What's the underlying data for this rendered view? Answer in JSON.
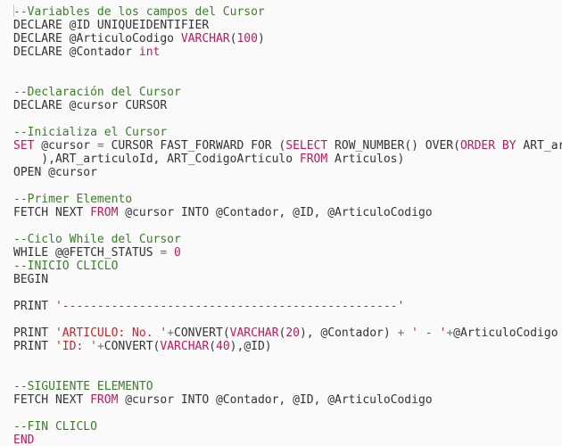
{
  "editor": {
    "language": "T-SQL",
    "colors": {
      "background": "#fafafa",
      "text": "#333333",
      "comment": "#3c7d2b",
      "keyword": "#c2185b",
      "number": "#c2185b",
      "string": "#d0202a",
      "operator": "#6b7280"
    },
    "lines": [
      [
        {
          "t": "cm",
          "v": "--Variables de los campos del Cursor"
        }
      ],
      [
        {
          "t": "tx",
          "v": "DECLARE @ID UNIQUEIDENTIFIER"
        }
      ],
      [
        {
          "t": "tx",
          "v": "DECLARE @ArticuloCodigo "
        },
        {
          "t": "kw",
          "v": "VARCHAR"
        },
        {
          "t": "tx",
          "v": "("
        },
        {
          "t": "num",
          "v": "100"
        },
        {
          "t": "tx",
          "v": ")"
        }
      ],
      [
        {
          "t": "tx",
          "v": "DECLARE @Contador "
        },
        {
          "t": "kw",
          "v": "int"
        }
      ],
      [],
      [],
      [
        {
          "t": "cm",
          "v": "--Declaración del Cursor"
        }
      ],
      [
        {
          "t": "tx",
          "v": "DECLARE @cursor CURSOR"
        }
      ],
      [],
      [
        {
          "t": "cm",
          "v": "--Inicializa el Cursor"
        }
      ],
      [
        {
          "t": "kw",
          "v": "SET"
        },
        {
          "t": "tx",
          "v": " @cursor "
        },
        {
          "t": "op",
          "v": "="
        },
        {
          "t": "tx",
          "v": " CURSOR FAST_FORWARD FOR ("
        },
        {
          "t": "kw",
          "v": "SELECT"
        },
        {
          "t": "tx",
          "v": " ROW_NUMBER() OVER("
        },
        {
          "t": "kw",
          "v": "ORDER BY"
        },
        {
          "t": "tx",
          "v": " ART_articuloId"
        }
      ],
      [
        {
          "t": "tx",
          "v": "    ),ART_articuloId, ART_CodigoArticulo "
        },
        {
          "t": "kw",
          "v": "FROM"
        },
        {
          "t": "tx",
          "v": " Articulos)"
        }
      ],
      [
        {
          "t": "tx",
          "v": "OPEN @cursor"
        }
      ],
      [],
      [
        {
          "t": "cm",
          "v": "--Primer Elemento"
        }
      ],
      [
        {
          "t": "tx",
          "v": "FETCH NEXT "
        },
        {
          "t": "kw",
          "v": "FROM"
        },
        {
          "t": "tx",
          "v": " @cursor INTO @Contador, @ID, @ArticuloCodigo"
        }
      ],
      [],
      [
        {
          "t": "cm",
          "v": "--Ciclo While del Cursor"
        }
      ],
      [
        {
          "t": "tx",
          "v": "WHILE @@FETCH_STATUS "
        },
        {
          "t": "op",
          "v": "="
        },
        {
          "t": "tx",
          "v": " "
        },
        {
          "t": "num",
          "v": "0"
        }
      ],
      [
        {
          "t": "cm",
          "v": "--INICIO CLICLO"
        }
      ],
      [
        {
          "t": "tx",
          "v": "BEGIN"
        }
      ],
      [],
      [
        {
          "t": "tx",
          "v": "PRINT "
        },
        {
          "t": "str",
          "v": "'------------------------------------------------'"
        }
      ],
      [],
      [
        {
          "t": "tx",
          "v": "PRINT "
        },
        {
          "t": "str",
          "v": "'ARTICULO: No. '"
        },
        {
          "t": "op",
          "v": "+"
        },
        {
          "t": "tx",
          "v": "CONVERT("
        },
        {
          "t": "kw",
          "v": "VARCHAR"
        },
        {
          "t": "tx",
          "v": "("
        },
        {
          "t": "num",
          "v": "20"
        },
        {
          "t": "tx",
          "v": "), @Contador) "
        },
        {
          "t": "op",
          "v": "+"
        },
        {
          "t": "tx",
          "v": " "
        },
        {
          "t": "str",
          "v": "' - '"
        },
        {
          "t": "op",
          "v": "+"
        },
        {
          "t": "tx",
          "v": "@ArticuloCodigo"
        }
      ],
      [
        {
          "t": "tx",
          "v": "PRINT "
        },
        {
          "t": "str",
          "v": "'ID: '"
        },
        {
          "t": "op",
          "v": "+"
        },
        {
          "t": "tx",
          "v": "CONVERT("
        },
        {
          "t": "kw",
          "v": "VARCHAR"
        },
        {
          "t": "tx",
          "v": "("
        },
        {
          "t": "num",
          "v": "40"
        },
        {
          "t": "tx",
          "v": "),@ID)"
        }
      ],
      [],
      [],
      [
        {
          "t": "cm",
          "v": "--SIGUIENTE ELEMENTO"
        }
      ],
      [
        {
          "t": "tx",
          "v": "FETCH NEXT "
        },
        {
          "t": "kw",
          "v": "FROM"
        },
        {
          "t": "tx",
          "v": " @cursor INTO @Contador, @ID, @ArticuloCodigo"
        }
      ],
      [],
      [
        {
          "t": "cm",
          "v": "--FIN CLICLO"
        }
      ],
      [
        {
          "t": "kw",
          "v": "END"
        }
      ]
    ]
  }
}
